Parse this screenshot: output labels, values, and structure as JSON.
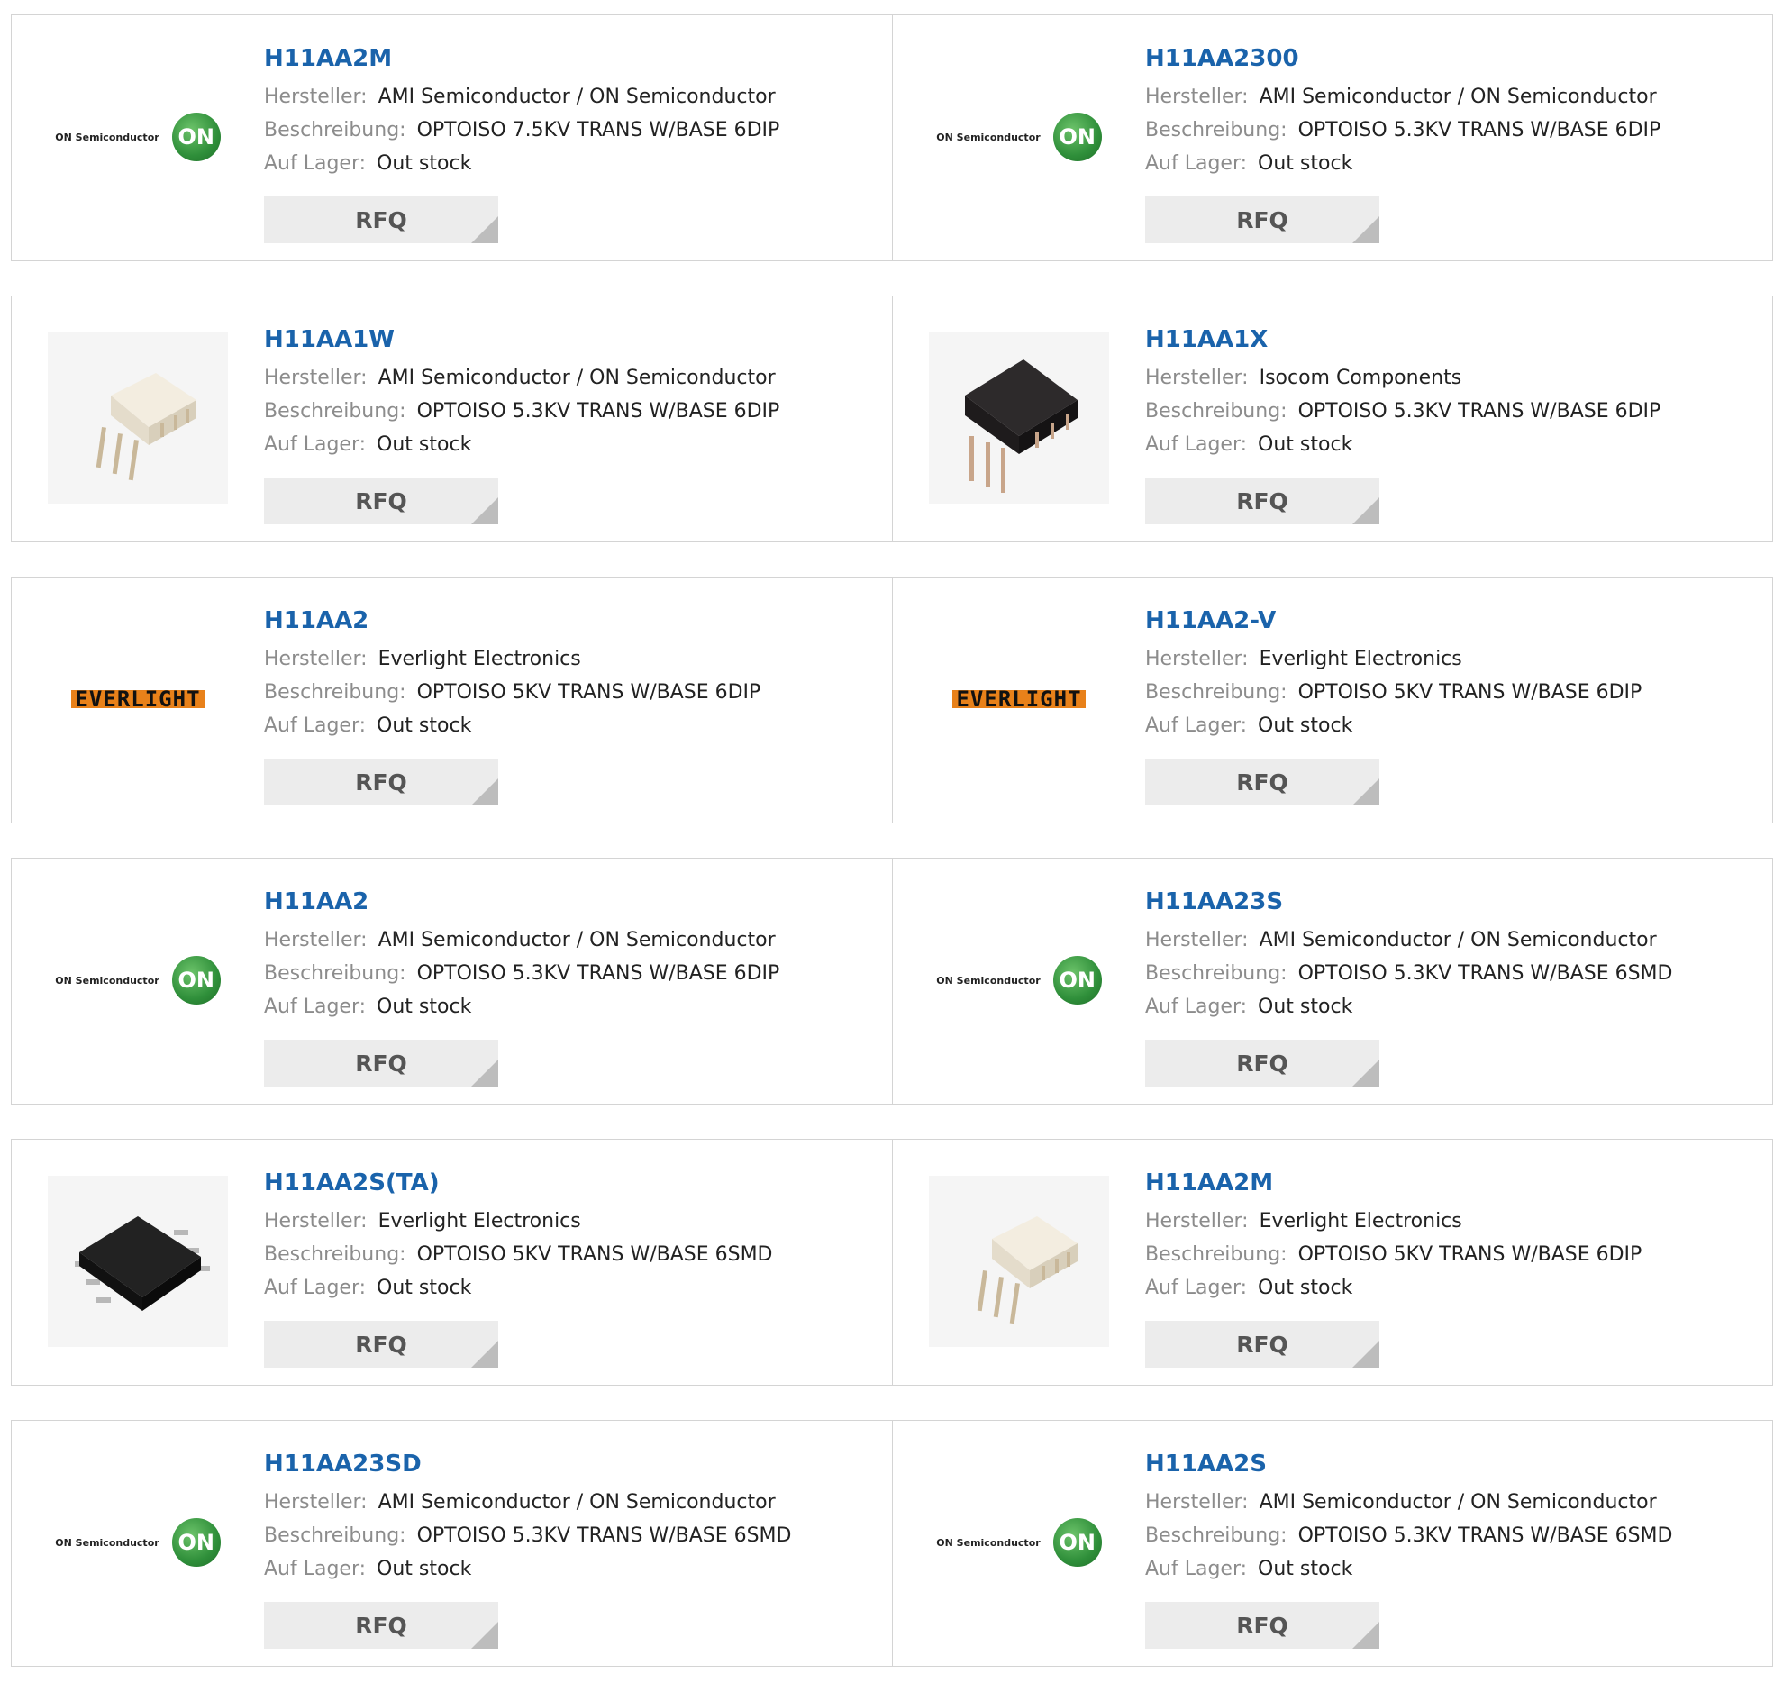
{
  "labels": {
    "manufacturer": "Hersteller:",
    "description": "Beschreibung:",
    "stock": "Auf Lager:",
    "rfq": "RFQ"
  },
  "logo": {
    "on_text": "ON Semiconductor",
    "on_mark": "ON",
    "everlight_text": "EVERLIGHT"
  },
  "products": [
    {
      "part": "H11AA2M",
      "manufacturer": "AMI Semiconductor / ON Semiconductor",
      "description": "OPTOISO 7.5KV TRANS W/BASE 6DIP",
      "stock": "Out stock",
      "image": "on-semiconductor-logo"
    },
    {
      "part": "H11AA2300",
      "manufacturer": "AMI Semiconductor / ON Semiconductor",
      "description": "OPTOISO 5.3KV TRANS W/BASE 6DIP",
      "stock": "Out stock",
      "image": "on-semiconductor-logo"
    },
    {
      "part": "H11AA1W",
      "manufacturer": "AMI Semiconductor / ON Semiconductor",
      "description": "OPTOISO 5.3KV TRANS W/BASE 6DIP",
      "stock": "Out stock",
      "image": "white-dip-chip-photo"
    },
    {
      "part": "H11AA1X",
      "manufacturer": "Isocom Components",
      "description": "OPTOISO 5.3KV TRANS W/BASE 6DIP",
      "stock": "Out stock",
      "image": "black-dip-chip-photo"
    },
    {
      "part": "H11AA2",
      "manufacturer": "Everlight Electronics",
      "description": "OPTOISO 5KV TRANS W/BASE 6DIP",
      "stock": "Out stock",
      "image": "everlight-logo"
    },
    {
      "part": "H11AA2-V",
      "manufacturer": "Everlight Electronics",
      "description": "OPTOISO 5KV TRANS W/BASE 6DIP",
      "stock": "Out stock",
      "image": "everlight-logo"
    },
    {
      "part": "H11AA2",
      "manufacturer": "AMI Semiconductor / ON Semiconductor",
      "description": "OPTOISO 5.3KV TRANS W/BASE 6DIP",
      "stock": "Out stock",
      "image": "on-semiconductor-logo"
    },
    {
      "part": "H11AA23S",
      "manufacturer": "AMI Semiconductor / ON Semiconductor",
      "description": "OPTOISO 5.3KV TRANS W/BASE 6SMD",
      "stock": "Out stock",
      "image": "on-semiconductor-logo"
    },
    {
      "part": "H11AA2S(TA)",
      "manufacturer": "Everlight Electronics",
      "description": "OPTOISO 5KV TRANS W/BASE 6SMD",
      "stock": "Out stock",
      "image": "black-smd-chip-photo"
    },
    {
      "part": "H11AA2M",
      "manufacturer": "Everlight Electronics",
      "description": "OPTOISO 5KV TRANS W/BASE 6DIP",
      "stock": "Out stock",
      "image": "white-dip-chip-photo"
    },
    {
      "part": "H11AA23SD",
      "manufacturer": "AMI Semiconductor / ON Semiconductor",
      "description": "OPTOISO 5.3KV TRANS W/BASE 6SMD",
      "stock": "Out stock",
      "image": "on-semiconductor-logo"
    },
    {
      "part": "H11AA2S",
      "manufacturer": "AMI Semiconductor / ON Semiconductor",
      "description": "OPTOISO 5.3KV TRANS W/BASE 6SMD",
      "stock": "Out stock",
      "image": "on-semiconductor-logo"
    }
  ]
}
